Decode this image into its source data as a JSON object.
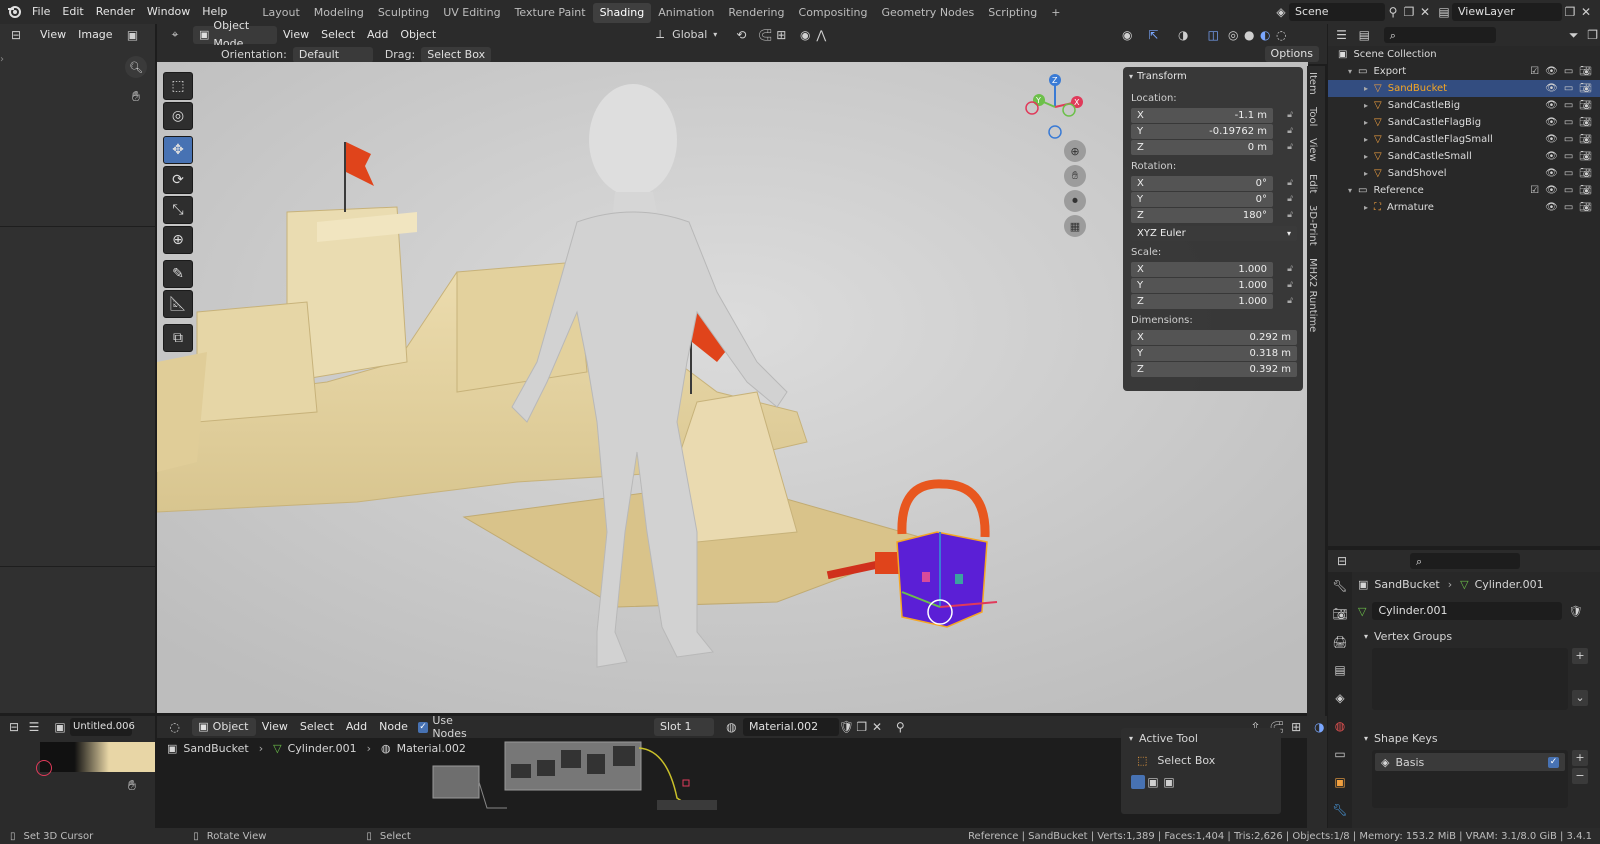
{
  "topbar": {
    "menus": [
      "File",
      "Edit",
      "Render",
      "Window",
      "Help"
    ],
    "workspaces": [
      "Layout",
      "Modeling",
      "Sculpting",
      "UV Editing",
      "Texture Paint",
      "Shading",
      "Animation",
      "Rendering",
      "Compositing",
      "Geometry Nodes",
      "Scripting"
    ],
    "active_workspace": "Shading",
    "add_workspace": "+",
    "scene": "Scene",
    "view_layer": "ViewLayer"
  },
  "image_editor": {
    "menus": [
      "View",
      "Image"
    ],
    "image_name": "Untitled.006"
  },
  "viewport": {
    "mode": "Object Mode",
    "menus": [
      "View",
      "Select",
      "Add",
      "Object"
    ],
    "orientation_label": "Orientation:",
    "orientation_value": "Default",
    "drag_label": "Drag:",
    "drag_value": "Select Box",
    "transform_space": "Global",
    "options": "Options"
  },
  "transform": {
    "title": "Transform",
    "location_label": "Location:",
    "location": [
      {
        "axis": "X",
        "value": "-1.1 m"
      },
      {
        "axis": "Y",
        "value": "-0.19762 m"
      },
      {
        "axis": "Z",
        "value": "0 m"
      }
    ],
    "rotation_label": "Rotation:",
    "rotation": [
      {
        "axis": "X",
        "value": "0°"
      },
      {
        "axis": "Y",
        "value": "0°"
      },
      {
        "axis": "Z",
        "value": "180°"
      }
    ],
    "rotation_mode": "XYZ Euler",
    "scale_label": "Scale:",
    "scale": [
      {
        "axis": "X",
        "value": "1.000"
      },
      {
        "axis": "Y",
        "value": "1.000"
      },
      {
        "axis": "Z",
        "value": "1.000"
      }
    ],
    "dimensions_label": "Dimensions:",
    "dimensions": [
      {
        "axis": "X",
        "value": "0.292 m"
      },
      {
        "axis": "Y",
        "value": "0.318 m"
      },
      {
        "axis": "Z",
        "value": "0.392 m"
      }
    ]
  },
  "side_tabs": [
    "Item",
    "Tool",
    "View",
    "Edit",
    "3D-Print",
    "MHX2 Runtime"
  ],
  "outliner": {
    "root": "Scene Collection",
    "items": [
      {
        "name": "Export",
        "type": "collection"
      },
      {
        "name": "SandBucket",
        "type": "mesh"
      },
      {
        "name": "SandCastleBig",
        "type": "mesh"
      },
      {
        "name": "SandCastleFlagBig",
        "type": "mesh"
      },
      {
        "name": "SandCastleFlagSmall",
        "type": "mesh"
      },
      {
        "name": "SandCastleSmall",
        "type": "mesh"
      },
      {
        "name": "SandShovel",
        "type": "mesh"
      },
      {
        "name": "Reference",
        "type": "collection"
      },
      {
        "name": "Armature",
        "type": "armature"
      }
    ]
  },
  "properties": {
    "breadcrumb_object": "SandBucket",
    "breadcrumb_data": "Cylinder.001",
    "data_name": "Cylinder.001",
    "vertex_groups": "Vertex Groups",
    "shape_keys": "Shape Keys",
    "shape_key_basis": "Basis"
  },
  "node_editor": {
    "mode": "Object",
    "menus": [
      "View",
      "Select",
      "Add",
      "Node"
    ],
    "use_nodes": "Use Nodes",
    "slot": "Slot 1",
    "material": "Material.002",
    "breadcrumb": [
      "SandBucket",
      "Cylinder.001",
      "Material.002"
    ],
    "active_tool_title": "Active Tool",
    "active_tool_name": "Select Box"
  },
  "statusbar": {
    "hint1": "Set 3D Cursor",
    "hint2": "Rotate View",
    "hint3": "Select",
    "stats": "Reference | SandBucket | Verts:1,389 | Faces:1,404 | Tris:2,626 | Objects:1/8 | Memory: 153.2 MiB | VRAM: 3.1/8.0 GiB | 3.4.1"
  },
  "colors": {
    "accent": "#4772b3",
    "selected_object": "#f5a623",
    "sand": "#e8d6a6",
    "bucket": "#5b1fd6",
    "flag": "#e0441b"
  }
}
